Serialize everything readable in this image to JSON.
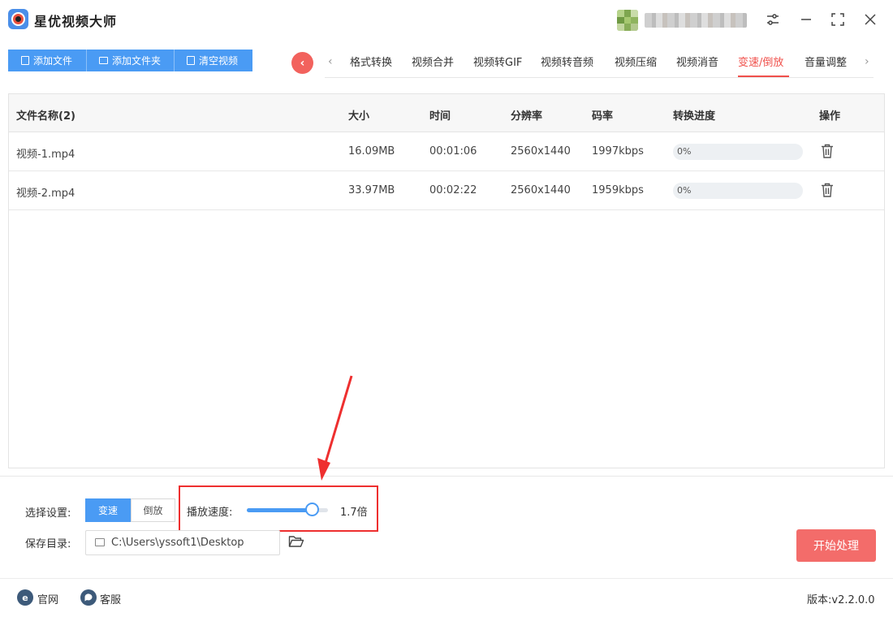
{
  "app": {
    "title": "星优视频大师"
  },
  "toolbar": {
    "add_file": "添加文件",
    "add_folder": "添加文件夹",
    "clear_videos": "清空视频"
  },
  "tabs": [
    {
      "label": "格式转换"
    },
    {
      "label": "视频合并"
    },
    {
      "label": "视频转GIF"
    },
    {
      "label": "视频转音频"
    },
    {
      "label": "视频压缩"
    },
    {
      "label": "视频消音"
    },
    {
      "label": "变速/倒放",
      "active": true
    },
    {
      "label": "音量调整"
    }
  ],
  "table": {
    "headers": {
      "name": "文件名称(2)",
      "size": "大小",
      "duration": "时间",
      "resolution": "分辨率",
      "bitrate": "码率",
      "progress": "转换进度",
      "actions": "操作"
    },
    "rows": [
      {
        "name": "视频-1.mp4",
        "size": "16.09MB",
        "duration": "00:01:06",
        "resolution": "2560x1440",
        "bitrate": "1997kbps",
        "progress_text": "0%",
        "progress": 0
      },
      {
        "name": "视频-2.mp4",
        "size": "33.97MB",
        "duration": "00:02:22",
        "resolution": "2560x1440",
        "bitrate": "1959kbps",
        "progress_text": "0%",
        "progress": 0
      }
    ]
  },
  "settings": {
    "mode_label": "选择设置:",
    "mode_speed": "变速",
    "mode_reverse": "倒放",
    "speed_label": "播放速度:",
    "speed_value": "1.7倍",
    "speed_fraction": 0.8,
    "save_label": "保存目录:",
    "save_path": "C:\\Users\\yssoft1\\Desktop",
    "start_button": "开始处理"
  },
  "statusbar": {
    "website": "官网",
    "support": "客服",
    "version": "版本:v2.2.0.0"
  },
  "colors": {
    "primary": "#4a9bf4",
    "accent": "#f0504b",
    "highlight_box": "#ee2f2f",
    "start_button": "#f36c6a"
  }
}
